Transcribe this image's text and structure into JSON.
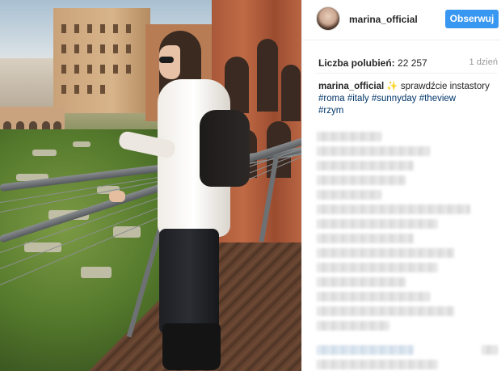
{
  "post": {
    "image_alt": ""
  },
  "header": {
    "username": "marina_official",
    "follow_label": "Obserwuj"
  },
  "stats": {
    "likes_label": "Liczba polubień:",
    "likes_count": "22 257",
    "age": "1 dzień"
  },
  "caption": {
    "author": "marina_official",
    "text": "✨ sprawdźcie instastory",
    "hashtags": [
      "#roma",
      "#italy",
      "#sunnyday",
      "#theview",
      "#rzym"
    ]
  },
  "colors": {
    "accent": "#3897f0",
    "hashtag": "#003569",
    "text": "#262626",
    "muted": "#999999"
  },
  "icons": {
    "avatar": "profile-avatar"
  }
}
